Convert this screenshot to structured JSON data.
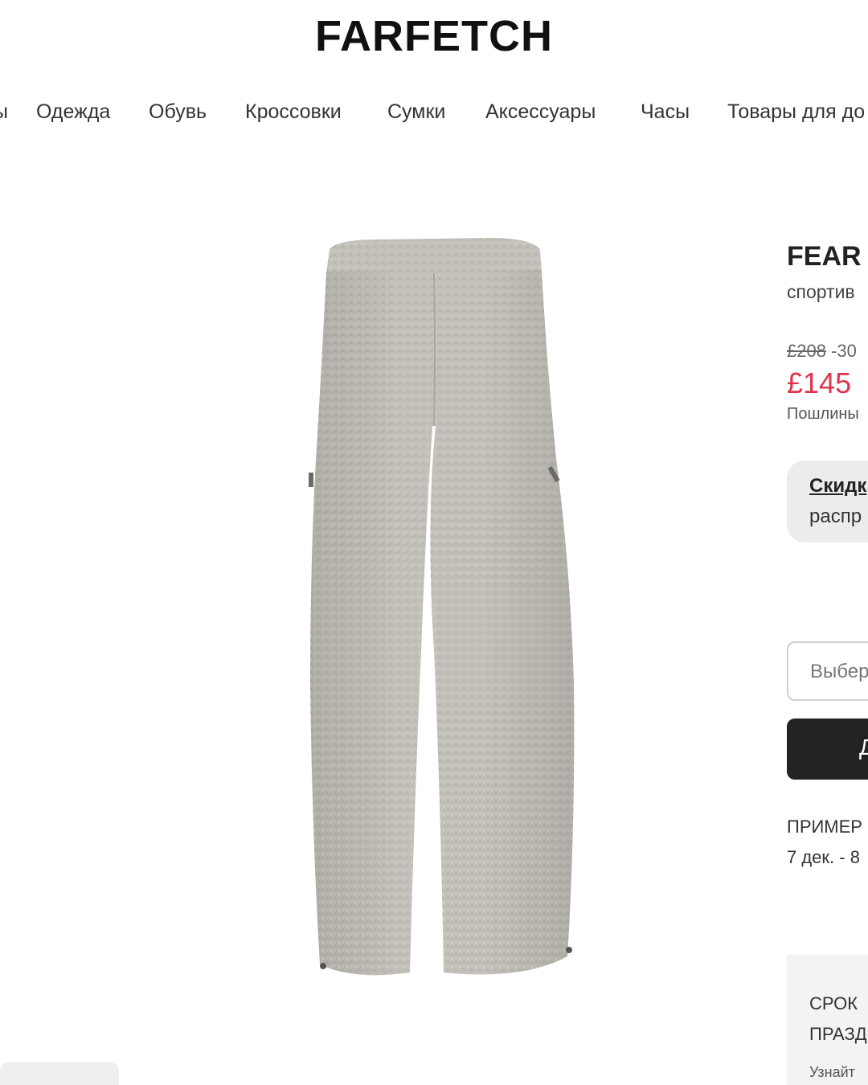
{
  "header": {
    "logo": "FARFETCH"
  },
  "nav": {
    "items": [
      {
        "label": "Одежда"
      },
      {
        "label": "Обувь"
      },
      {
        "label": "Кроссовки"
      },
      {
        "label": "Сумки"
      },
      {
        "label": "Аксессуары"
      },
      {
        "label": "Часы"
      },
      {
        "label": "Товары для до"
      }
    ]
  },
  "product": {
    "brand": "FEAR",
    "subtitle": "спортив",
    "old_price": "£208",
    "discount": "-30",
    "price": "£145",
    "duties_note": "Пошлины",
    "promo": {
      "link": "Скидк",
      "text": "распр"
    },
    "size_select": {
      "placeholder": "Выбер"
    },
    "add_button": {
      "label": "Д"
    },
    "delivery": {
      "label": "ПРИМЕР",
      "dates": "7 дек. - 8"
    },
    "holiday": {
      "line1": "СРОК",
      "line2": "ПРАЗД",
      "line3": "Узнайт"
    }
  },
  "colors": {
    "sale_price": "#e0334d",
    "button_bg": "#222222",
    "promo_bg": "#ececec"
  }
}
